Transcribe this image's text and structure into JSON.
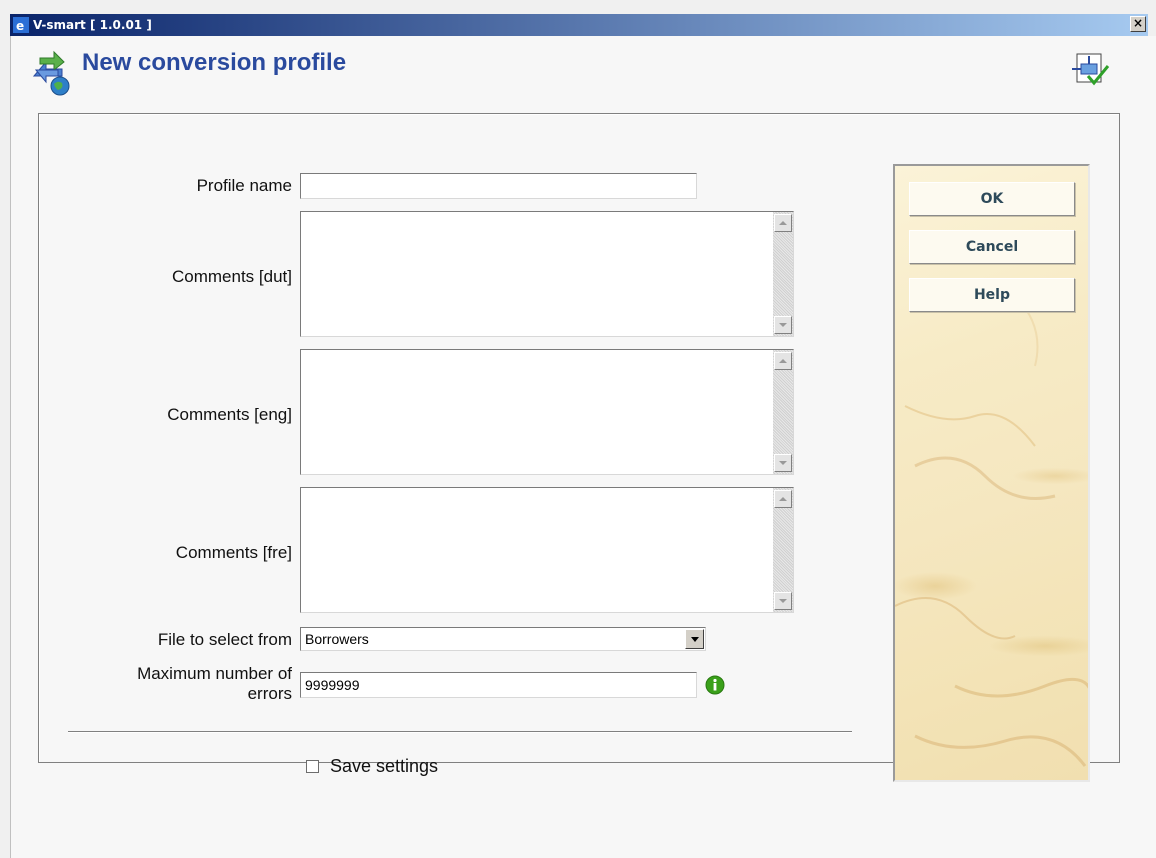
{
  "window": {
    "title": "V-smart [ 1.0.01 ]",
    "close_label": "×"
  },
  "header": {
    "title": "New conversion profile",
    "icon": "conversion-profile-icon",
    "corner_icon": "document-check-icon"
  },
  "form": {
    "profile_name": {
      "label": "Profile name",
      "value": ""
    },
    "comments_dut": {
      "label": "Comments [dut]",
      "value": ""
    },
    "comments_eng": {
      "label": "Comments [eng]",
      "value": ""
    },
    "comments_fre": {
      "label": "Comments [fre]",
      "value": ""
    },
    "file_to_select": {
      "label": "File to select from",
      "selected": "Borrowers"
    },
    "max_errors": {
      "label_line1": "Maximum number of",
      "label_line2": "errors",
      "value": "9999999",
      "info_icon": "info-icon"
    },
    "save_settings": {
      "label": "Save settings",
      "checked": false
    }
  },
  "side_buttons": {
    "ok": "OK",
    "cancel": "Cancel",
    "help": "Help"
  },
  "colors": {
    "title_blue": "#2a4a9e",
    "button_text": "#2e4a5a",
    "info_green": "#3aa01a"
  }
}
